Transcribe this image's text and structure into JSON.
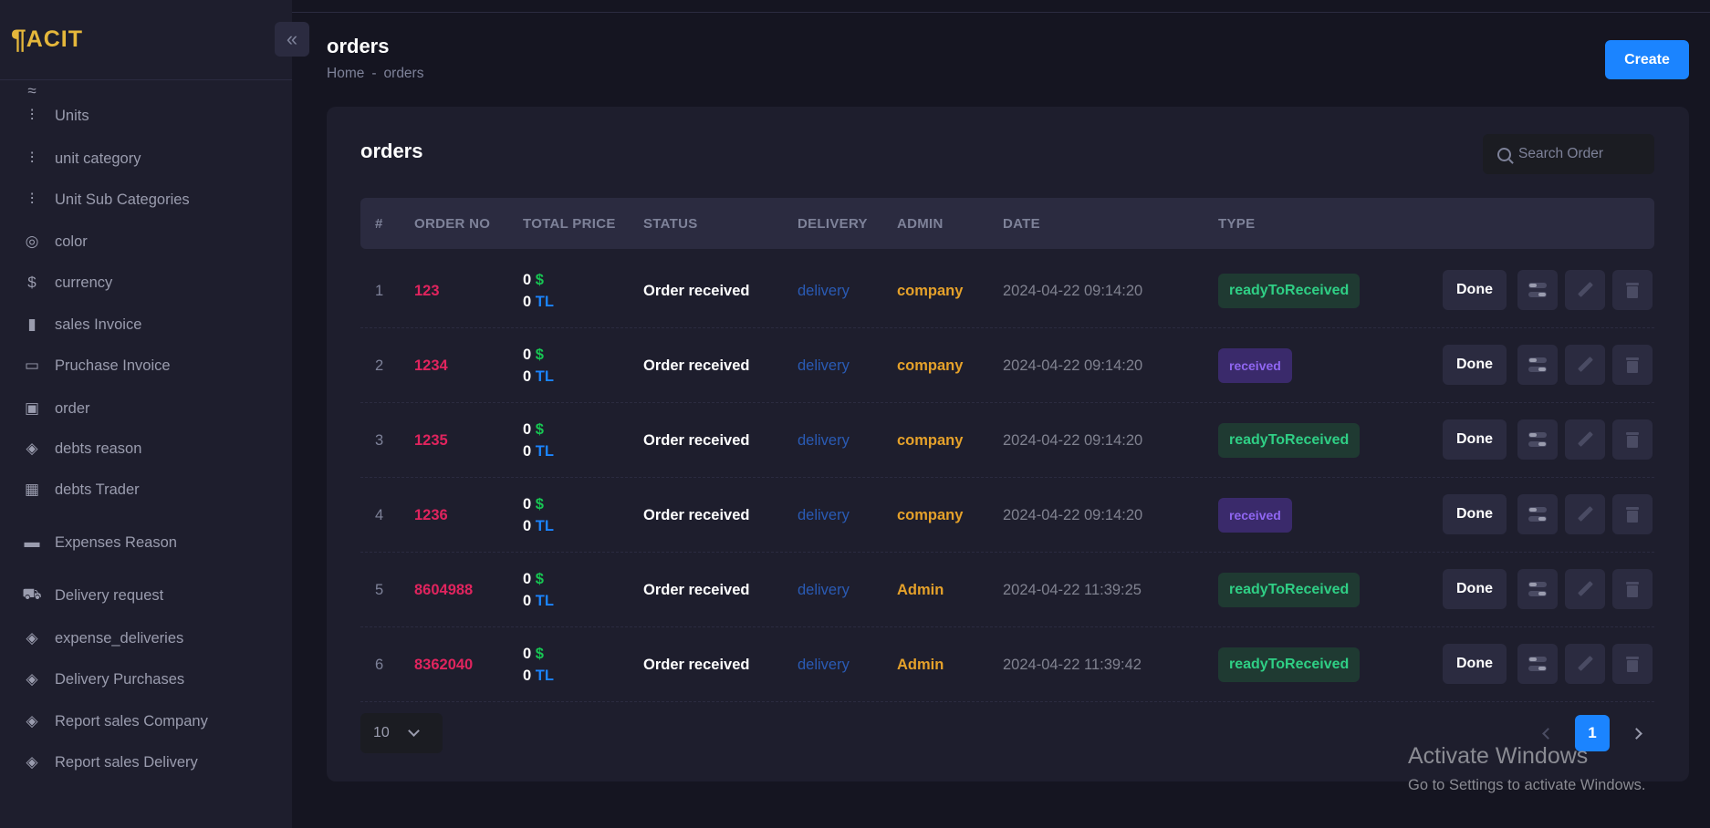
{
  "logo": {
    "text": "ACIT"
  },
  "sidebar": {
    "items": [
      {
        "label": "",
        "icon": "partial-icon"
      },
      {
        "label": "Units",
        "icon": "hierarchy-icon"
      },
      {
        "label": "unit category",
        "icon": "hierarchy-icon"
      },
      {
        "label": "Unit Sub Categories",
        "icon": "hierarchy-icon"
      },
      {
        "label": "color",
        "icon": "palette-icon"
      },
      {
        "label": "currency",
        "icon": "dollar-circle-icon"
      },
      {
        "label": "sales Invoice",
        "icon": "document-icon"
      },
      {
        "label": "Pruchase Invoice",
        "icon": "credit-card-icon"
      },
      {
        "label": "order",
        "icon": "briefcase-icon"
      },
      {
        "label": "debts reason",
        "icon": "diamond-dots-icon"
      },
      {
        "label": "debts Trader",
        "icon": "layout-icon"
      },
      {
        "label": "Expenses Reason",
        "icon": "money-icon"
      },
      {
        "label": "Delivery request",
        "icon": "truck-icon"
      },
      {
        "label": "expense_deliveries",
        "icon": "diamond-dots-icon"
      },
      {
        "label": "Delivery Purchases",
        "icon": "diamond-dots-icon"
      },
      {
        "label": "Report sales Company",
        "icon": "diamond-dots-icon"
      },
      {
        "label": "Report sales Delivery",
        "icon": "diamond-dots-icon"
      }
    ]
  },
  "header": {
    "title": "orders",
    "breadcrumb": [
      "Home",
      "-",
      "orders"
    ],
    "create_label": "Create"
  },
  "card": {
    "title": "orders",
    "search_placeholder": "Search Order"
  },
  "table": {
    "columns": [
      "#",
      "ORDER NO",
      "TOTAL PRICE",
      "STATUS",
      "DELIVERY",
      "ADMIN",
      "DATE",
      "TYPE"
    ],
    "rows": [
      {
        "idx": "1",
        "order_no": "123",
        "usd": "0",
        "usd_sym": "$",
        "tl": "0",
        "tl_sym": "TL",
        "status": "Order received",
        "delivery": "delivery",
        "admin": "company",
        "date": "2024-04-22 09:14:20",
        "type": "readyToReceived",
        "done": "Done"
      },
      {
        "idx": "2",
        "order_no": "1234",
        "usd": "0",
        "usd_sym": "$",
        "tl": "0",
        "tl_sym": "TL",
        "status": "Order received",
        "delivery": "delivery",
        "admin": "company",
        "date": "2024-04-22 09:14:20",
        "type": "received",
        "done": "Done"
      },
      {
        "idx": "3",
        "order_no": "1235",
        "usd": "0",
        "usd_sym": "$",
        "tl": "0",
        "tl_sym": "TL",
        "status": "Order received",
        "delivery": "delivery",
        "admin": "company",
        "date": "2024-04-22 09:14:20",
        "type": "readyToReceived",
        "done": "Done"
      },
      {
        "idx": "4",
        "order_no": "1236",
        "usd": "0",
        "usd_sym": "$",
        "tl": "0",
        "tl_sym": "TL",
        "status": "Order received",
        "delivery": "delivery",
        "admin": "company",
        "date": "2024-04-22 09:14:20",
        "type": "received",
        "done": "Done"
      },
      {
        "idx": "5",
        "order_no": "8604988",
        "usd": "0",
        "usd_sym": "$",
        "tl": "0",
        "tl_sym": "TL",
        "status": "Order received",
        "delivery": "delivery",
        "admin": "Admin",
        "date": "2024-04-22 11:39:25",
        "type": "readyToReceived",
        "done": "Done"
      },
      {
        "idx": "6",
        "order_no": "8362040",
        "usd": "0",
        "usd_sym": "$",
        "tl": "0",
        "tl_sym": "TL",
        "status": "Order received",
        "delivery": "delivery",
        "admin": "Admin",
        "date": "2024-04-22 11:39:42",
        "type": "readyToReceived",
        "done": "Done"
      }
    ]
  },
  "pagination": {
    "page_size": "10",
    "current_page": "1"
  },
  "watermark": {
    "line1": "Activate Windows",
    "line2": "Go to Settings to activate Windows."
  },
  "colors": {
    "accent": "#1b84ff",
    "order_no": "#e0245e",
    "admin": "#e5a12a",
    "ready_badge": "#2fcf85",
    "received_badge": "#8f66f1"
  }
}
